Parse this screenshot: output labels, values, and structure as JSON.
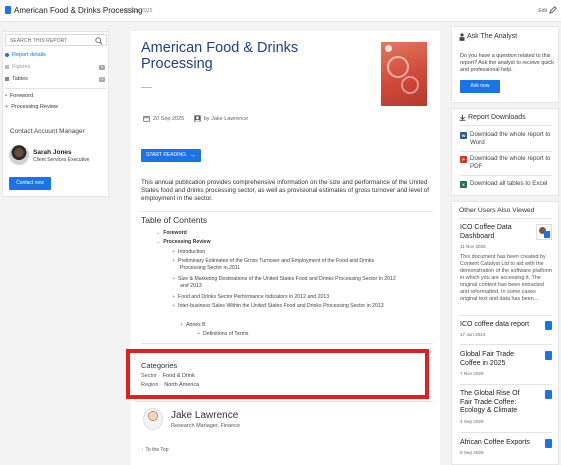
{
  "topbar": {
    "title": "American Food & Drinks Processing",
    "date": "20 Sep 2025",
    "edit_label": "Edit"
  },
  "sidebar": {
    "search_placeholder": "SEARCH THIS REPORT",
    "items": [
      {
        "label": "Report details",
        "badge": ""
      },
      {
        "label": "Figures",
        "badge": "0"
      },
      {
        "label": "Tables",
        "badge": "17"
      }
    ],
    "sections": [
      "Foreword",
      "Processing Review"
    ],
    "contact": {
      "heading": "Contact Account Manager",
      "name": "Sarah Jones",
      "role": "Client Services Executive",
      "button": "Contact now"
    }
  },
  "main": {
    "title": "American Food & Drinks Processing",
    "date": "20 Sep 2025",
    "author_by": "by Jake Lawrence",
    "start_button": "START READING",
    "abstract": "This annual publication provides comprehensive information on the size and performance of the United States food and drinks processing sector, as well as provisional estimates of gross turnover and level of employment in the sector.",
    "toc_heading": "Table of Contents",
    "toc": [
      {
        "text": "Foreword",
        "level": 0
      },
      {
        "text": "Processing Review",
        "level": 0
      },
      {
        "text": "Introduction",
        "level": 1
      },
      {
        "text": "Preliminary Estimates of the Gross Turnover and Employment of the Food and Drinks Processing Sector in 2011",
        "level": 1
      },
      {
        "text": "Size & Marketing Destinations of the United States Food and Drinks Processing Sector in 2012 and 2013",
        "level": 1
      },
      {
        "text": "Food and Drinks Sector Performance Indicators in 2012 and 2013",
        "level": 1
      },
      {
        "text": "Inter-business Sales Within the United States Food and Drinks Processing Sector in 2013",
        "level": 1
      },
      {
        "text": "Annex B",
        "level": 1
      },
      {
        "text": "Definitions of Terms",
        "level": 2
      }
    ],
    "categories": {
      "heading": "Categories",
      "rows": [
        {
          "key": "Sector",
          "value": "Food & Drink"
        },
        {
          "key": "Region",
          "value": "North America"
        }
      ]
    },
    "author": {
      "name": "Jake Lawrence",
      "role": "Research Manager, Finance"
    },
    "to_top": "To the Top"
  },
  "right": {
    "ask": {
      "heading": "Ask The Analyst",
      "text": "Do you have a question related to this report? Ask the analyst to receive quick and professional help.",
      "button": "Ask now"
    },
    "downloads": {
      "heading": "Report Downloads",
      "items": [
        {
          "label": "Download the whole report to Word",
          "icon": "word-icon",
          "color": "#2b579a",
          "glyph": "W"
        },
        {
          "label": "Download the whole report to PDF",
          "icon": "pdf-icon",
          "color": "#d93025",
          "glyph": "P"
        },
        {
          "label": "Download all tables to Excel",
          "icon": "excel-icon",
          "color": "#217346",
          "glyph": "X"
        }
      ]
    },
    "others": {
      "heading": "Other Users Also Viewed",
      "items": [
        {
          "title": "ICO Coffee Data Dashboard",
          "date": "11 Nov 2025",
          "desc": "This document has been created by Content Catalyst Ltd to aid with the demonstration of the software platform in which you are accessing it. The original content has been extracted and reformatted. In some cases original text and data has been..."
        },
        {
          "title": "ICO coffee data report",
          "date": "17 Jun 2024"
        },
        {
          "title": "Global Fair Trade Coffee in 2025",
          "date": "7 Nov 2025"
        },
        {
          "title": "The Global Rise Of Fair Trade Coffee: Ecology & Climate",
          "date": "4 Sep 2025"
        },
        {
          "title": "African Coffee Exports",
          "date": "8 Sep 2025"
        }
      ]
    }
  }
}
